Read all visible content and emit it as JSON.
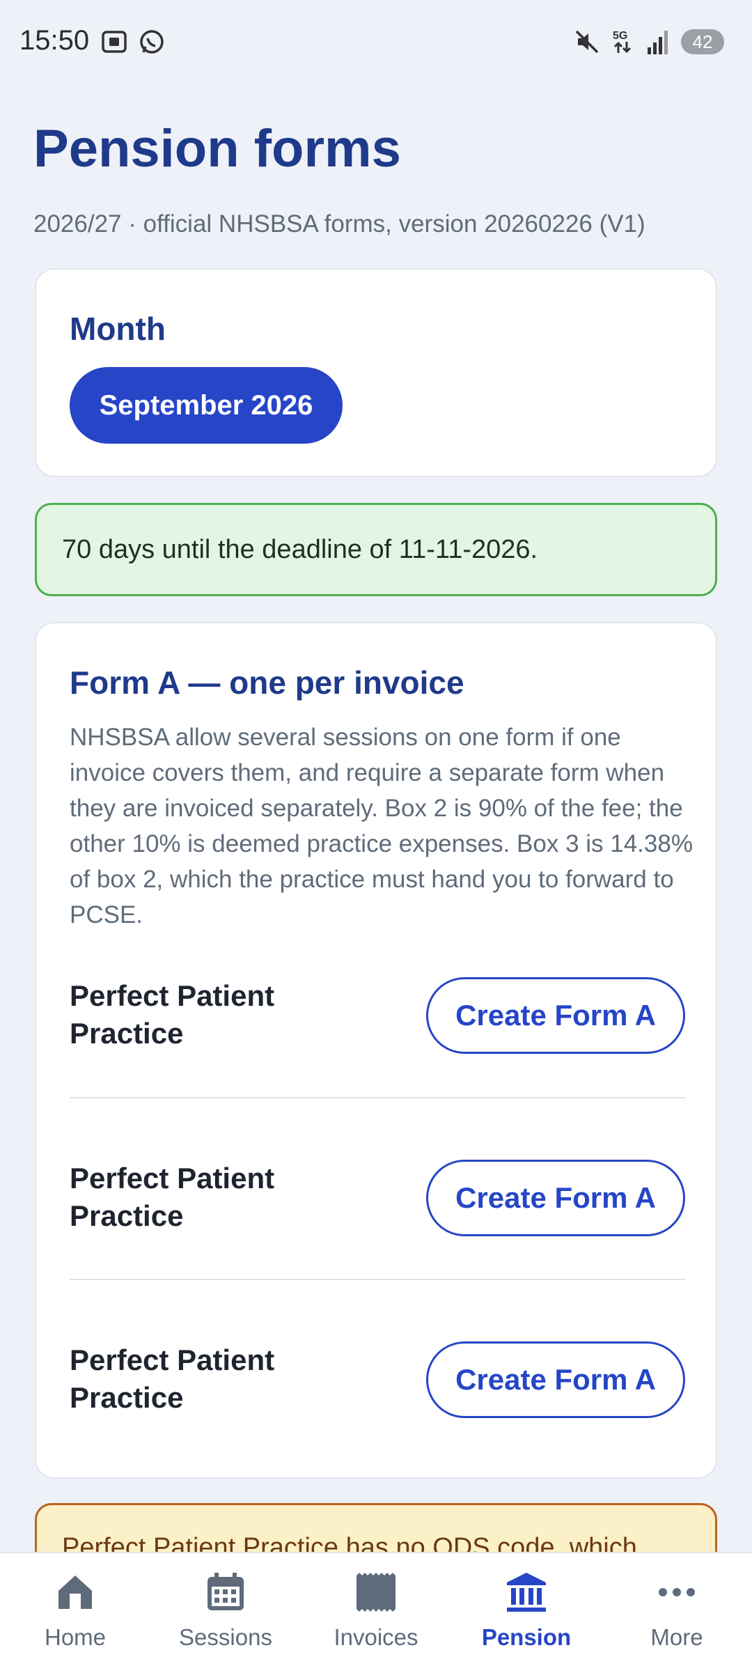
{
  "status_bar": {
    "time": "15:50",
    "battery": "42",
    "icons_left": [
      "screenshot-icon",
      "whatsapp-icon"
    ],
    "icons_right": [
      "mute-icon",
      "5g-icon",
      "signal-icon",
      "battery-icon"
    ]
  },
  "page": {
    "title": "Pension forms",
    "subtitle": "2026/27 · official NHSBSA forms, version 20260226 (V1)"
  },
  "month_card": {
    "label": "Month",
    "selected_month": "September 2026"
  },
  "deadline_banner": {
    "text": "70 days until the deadline of 11-11-2026."
  },
  "form_a_card": {
    "title": "Form A — one per invoice",
    "description": "NHSBSA allow several sessions on one form if one invoice covers them, and require a separate form when they are invoiced separately. Box 2 is 90% of the fee; the other 10% is deemed practice expenses. Box 3 is 14.38% of box 2, which the practice must hand you to forward to PCSE.",
    "rows": [
      {
        "practice": "Perfect Patient Practice",
        "button": "Create Form A"
      },
      {
        "practice": "Perfect Patient Practice",
        "button": "Create Form A"
      },
      {
        "practice": "Perfect Patient Practice",
        "button": "Create Form A"
      }
    ]
  },
  "warning_banner": {
    "text": "Perfect Patient Practice has no ODS code, which"
  },
  "bottom_nav": {
    "items": [
      {
        "label": "Home",
        "icon": "home-icon"
      },
      {
        "label": "Sessions",
        "icon": "calendar-icon"
      },
      {
        "label": "Invoices",
        "icon": "receipt-icon"
      },
      {
        "label": "Pension",
        "icon": "bank-icon"
      },
      {
        "label": "More",
        "icon": "more-icon"
      }
    ],
    "active": "Pension"
  },
  "colors": {
    "accent": "#2645c7",
    "title": "#1f3a8a",
    "success_bg": "#e3f6e3",
    "success_border": "#4caf50",
    "warning_bg": "#fbf0c8",
    "warning_border": "#b8651b"
  }
}
